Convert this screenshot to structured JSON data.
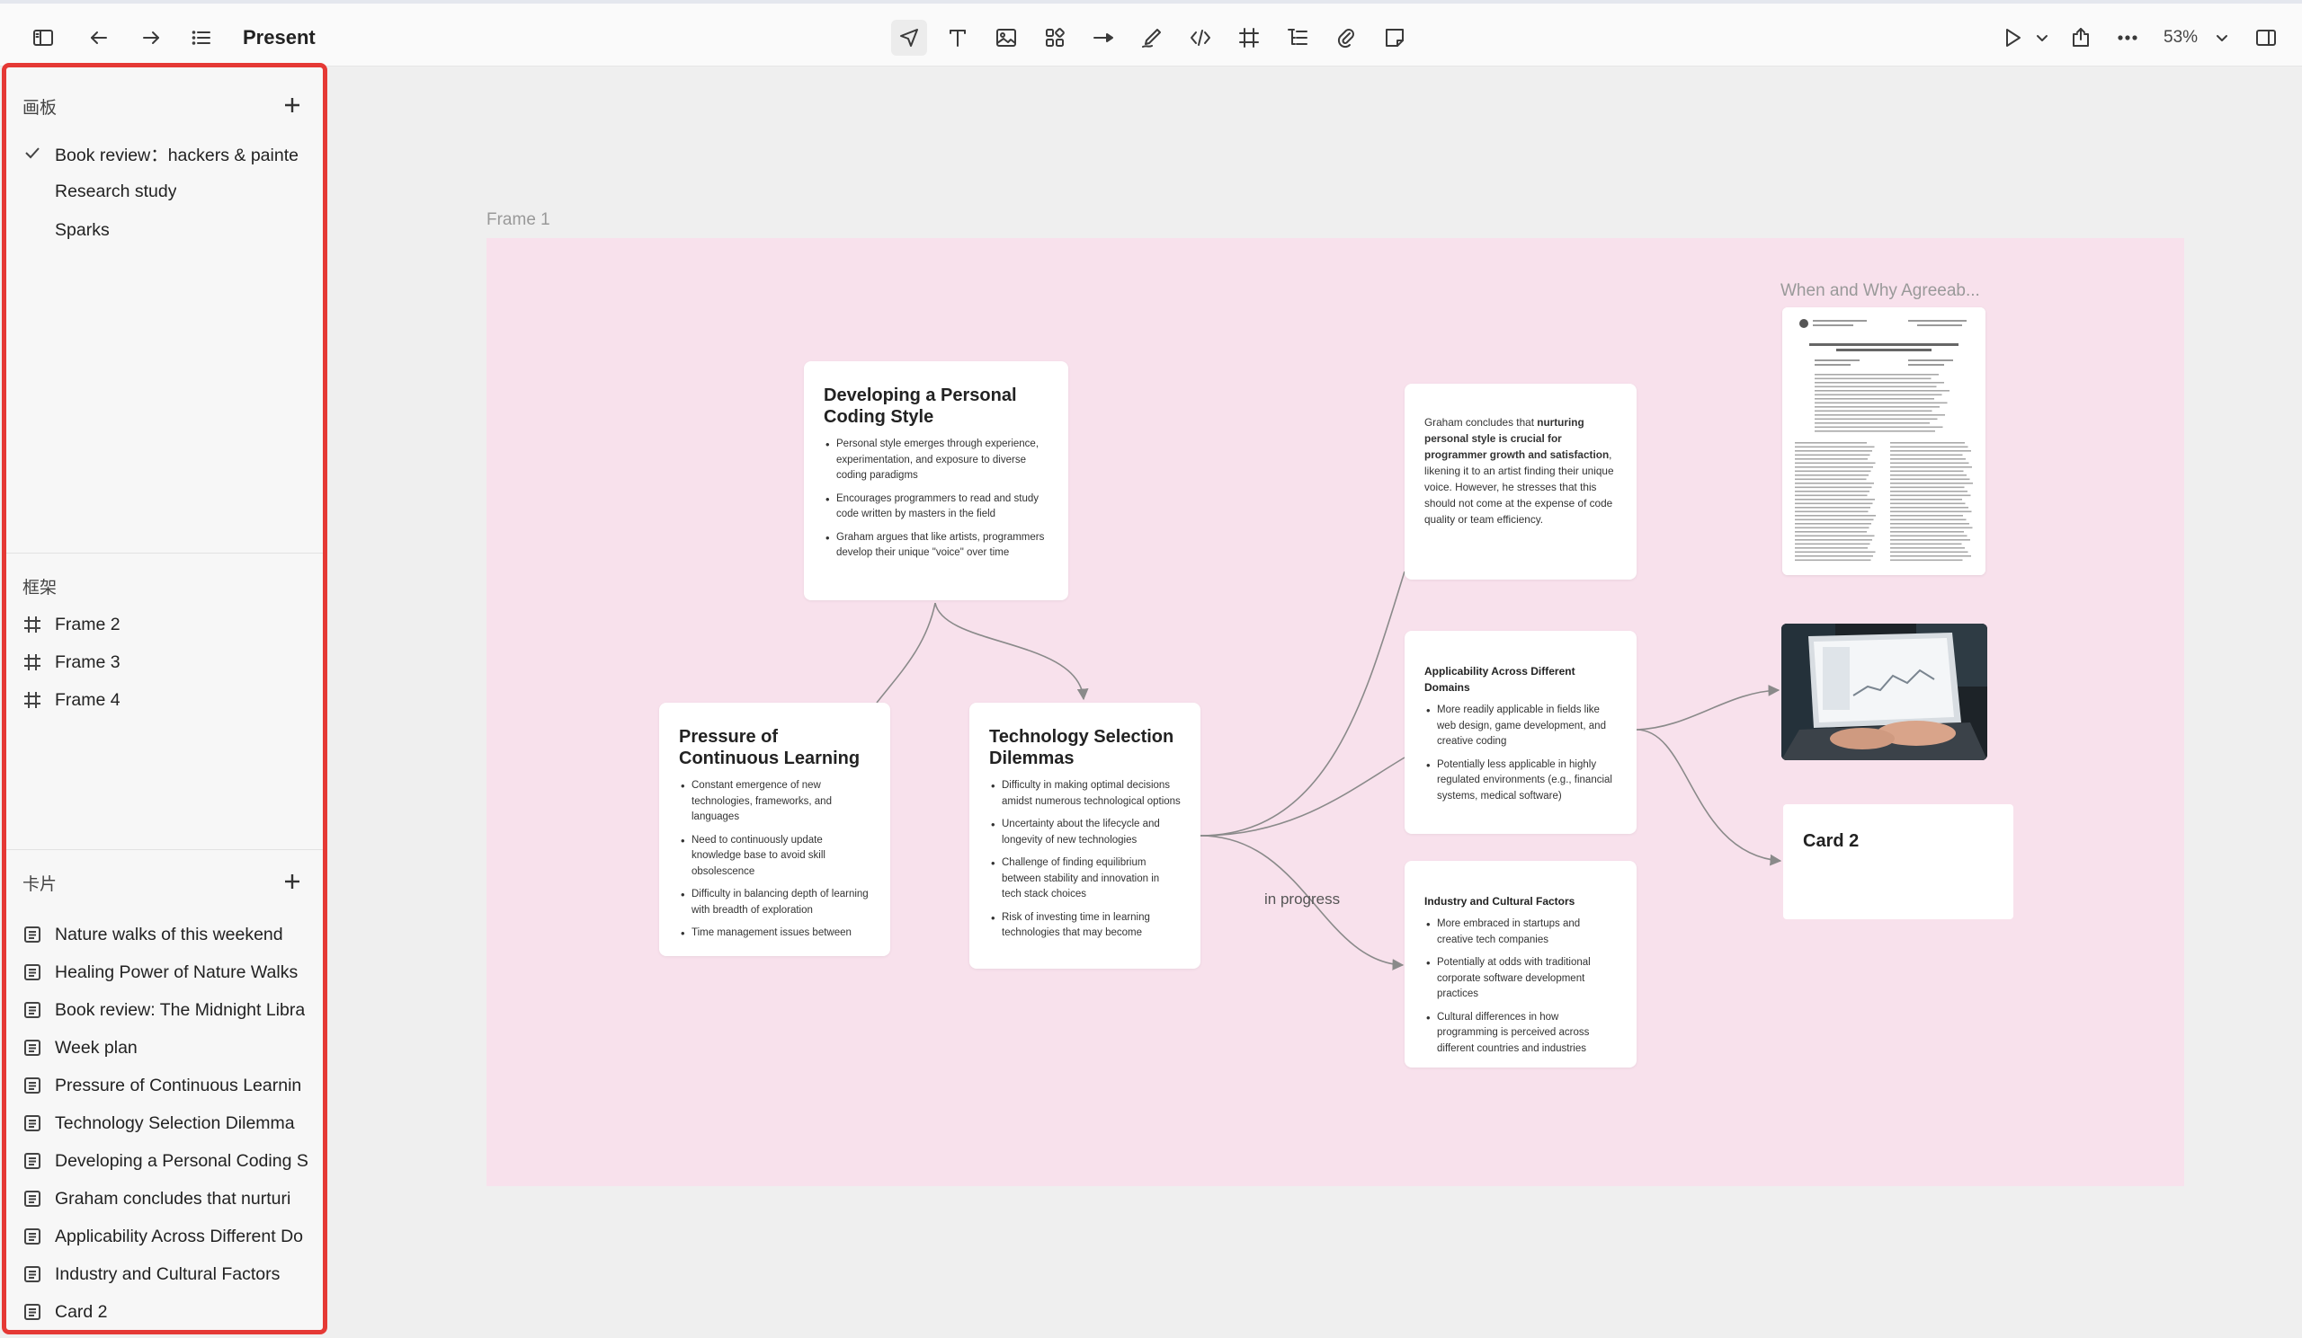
{
  "toolbar": {
    "present_label": "Present",
    "zoom_label": "53%"
  },
  "sidebar": {
    "boards_header": "画板",
    "boards": [
      {
        "label": "Book review：hackers & painte",
        "selected": true
      },
      {
        "label": "Research study",
        "selected": false
      },
      {
        "label": "Sparks",
        "selected": false
      }
    ],
    "frames_header": "框架",
    "frames": [
      {
        "label": "Frame 2"
      },
      {
        "label": "Frame 3"
      },
      {
        "label": "Frame 4"
      }
    ],
    "cards_header": "卡片",
    "cards": [
      {
        "label": "Nature walks of this weekend"
      },
      {
        "label": "Healing Power of Nature Walks"
      },
      {
        "label": "Book review: The Midnight Libra"
      },
      {
        "label": "Week plan"
      },
      {
        "label": "Pressure of Continuous Learnin"
      },
      {
        "label": "Technology Selection Dilemma"
      },
      {
        "label": "Developing a Personal Coding S"
      },
      {
        "label": "Graham concludes that nurturi"
      },
      {
        "label": "Applicability Across Different Do"
      },
      {
        "label": "Industry and Cultural Factors"
      },
      {
        "label": "Card 2"
      }
    ]
  },
  "canvas": {
    "frame_label": "Frame 1",
    "pdf_label": "When and Why Agreeab...",
    "edge_label": "in progress",
    "card_developing": {
      "title": "Developing a Personal Coding Style",
      "bullets": [
        "Personal style emerges through experience, experimentation, and exposure to diverse coding paradigms",
        "Encourages programmers to read and study code written by masters in the field",
        "Graham argues that like artists, programmers develop their unique \"voice\" over time"
      ]
    },
    "card_pressure": {
      "title": "Pressure of Continuous Learning",
      "bullets": [
        "Constant emergence of new technologies, frameworks, and languages",
        "Need to continuously update knowledge base to avoid skill obsolescence",
        "Difficulty in balancing depth of learning with breadth of exploration",
        "Time management issues between"
      ]
    },
    "card_techsel": {
      "title": "Technology Selection Dilemmas",
      "bullets": [
        "Difficulty in making optimal decisions amidst numerous technological options",
        "Uncertainty about the lifecycle and longevity of new technologies",
        "Challenge of finding equilibrium between stability and innovation in tech stack choices",
        "Risk of investing time in learning technologies that may become"
      ]
    },
    "card_graham": {
      "text_pre": "Graham concludes that ",
      "text_bold": "nurturing personal style is crucial for programmer growth and satisfaction",
      "text_post": ", likening it to an artist finding their unique voice. However, he stresses that this should not come at the expense of code quality or team efficiency."
    },
    "card_applicability": {
      "title": "Applicability Across Different Domains",
      "bullets": [
        "More readily applicable in fields like web design, game development, and creative coding",
        "Potentially less applicable in highly regulated environments (e.g., financial systems, medical software)"
      ]
    },
    "card_industry": {
      "title": "Industry and Cultural Factors",
      "bullets": [
        "More embraced in startups and creative tech companies",
        "Potentially at odds with traditional corporate software development practices",
        "Cultural differences in how programming is perceived across different countries and industries"
      ]
    },
    "card2_title": "Card 2"
  }
}
